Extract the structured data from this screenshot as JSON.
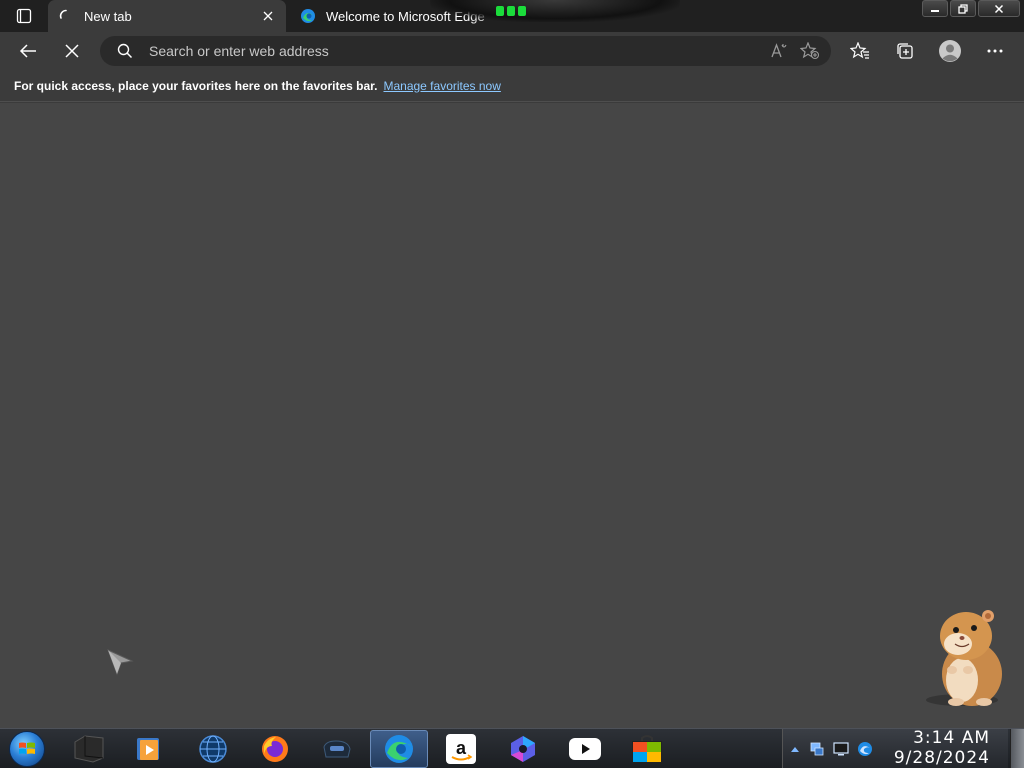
{
  "browser": {
    "tabs": [
      {
        "title": "New tab",
        "icon": "loading-icon",
        "active": true
      },
      {
        "title": "Welcome to Microsoft Edge",
        "icon": "edge-icon",
        "active": false
      }
    ],
    "address_bar": {
      "placeholder": "Search or enter web address",
      "value": ""
    },
    "favorites_bar": {
      "message": "For quick access, place your favorites here on the favorites bar.",
      "link": "Manage favorites now"
    }
  },
  "taskbar": {
    "apps": [
      {
        "name": "file-manager-icon"
      },
      {
        "name": "media-player-icon"
      },
      {
        "name": "globe-icon"
      },
      {
        "name": "firefox-icon"
      },
      {
        "name": "app-icon"
      },
      {
        "name": "edge-icon",
        "active": true
      },
      {
        "name": "amazon-icon"
      },
      {
        "name": "copilot-icon"
      },
      {
        "name": "youtube-icon"
      },
      {
        "name": "store-icon"
      }
    ],
    "clock": {
      "time": "3:14 AM",
      "date": "9/28/2024"
    }
  },
  "colors": {
    "accent_link": "#8cc8ff",
    "content_bg": "#464646",
    "tabbar_bg": "#202020"
  }
}
